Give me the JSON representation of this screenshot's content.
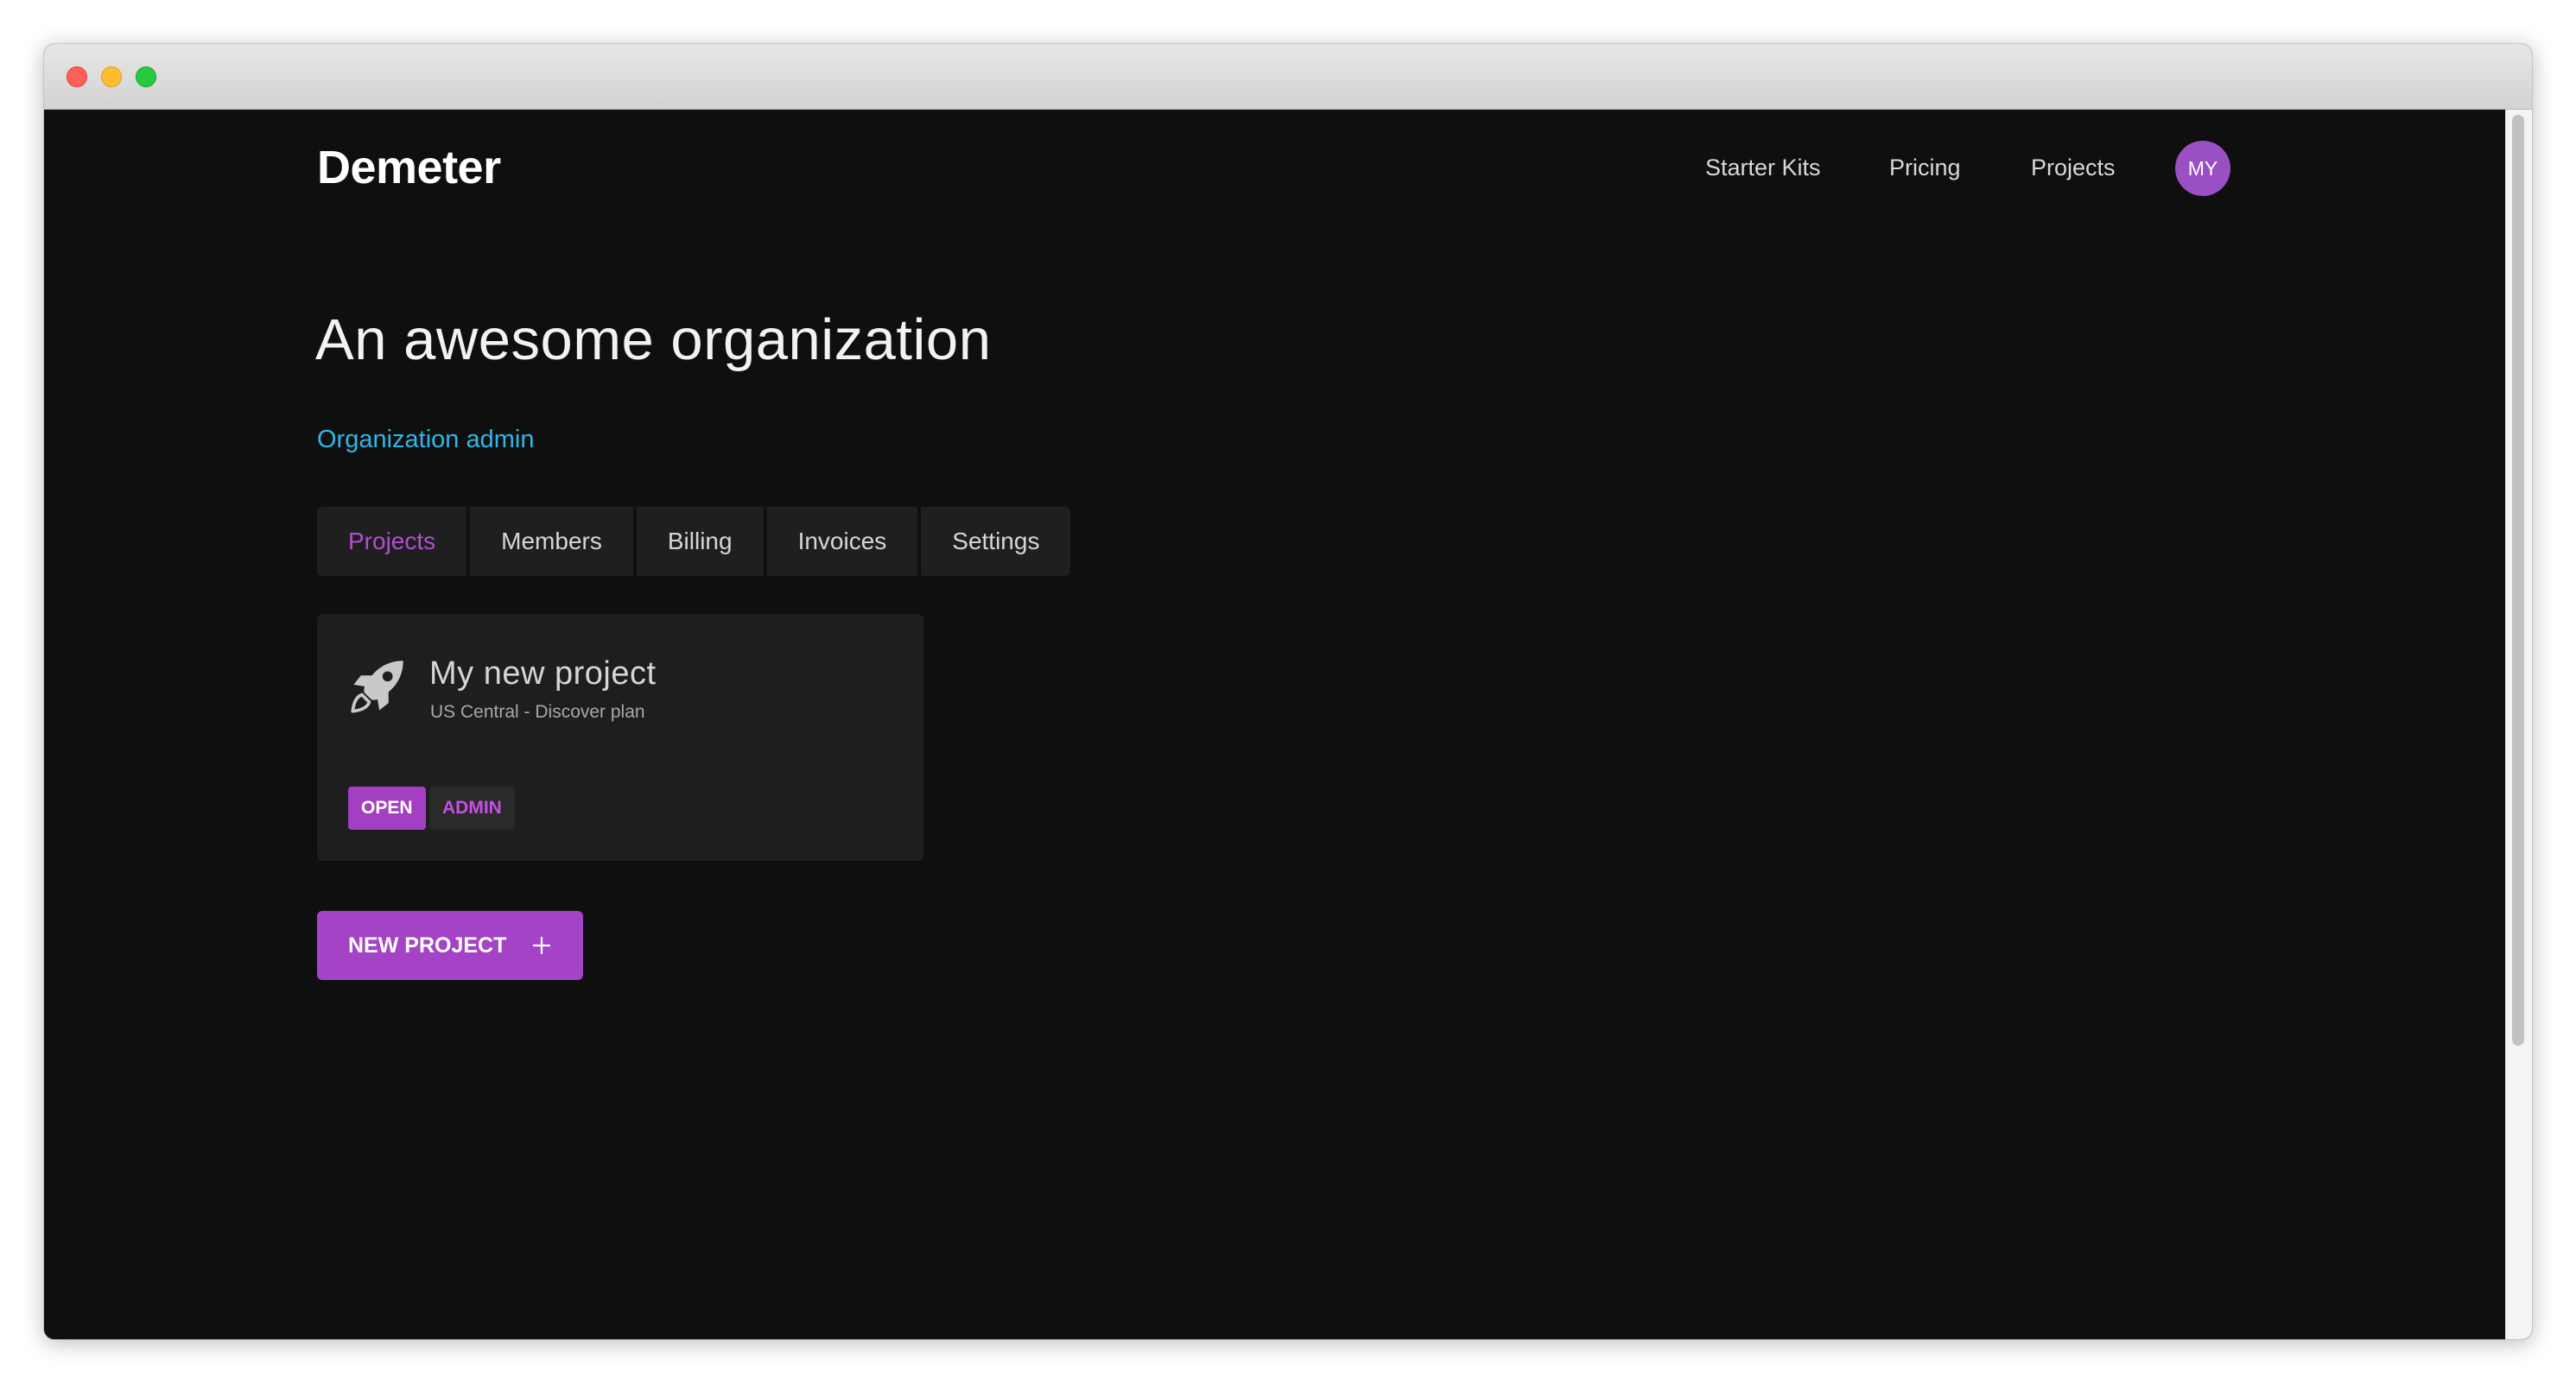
{
  "header": {
    "brand": "Demeter",
    "nav": [
      "Starter Kits",
      "Pricing",
      "Projects"
    ],
    "avatar_initials": "MY"
  },
  "organization": {
    "title": "An awesome organization",
    "role": "Organization admin"
  },
  "tabs": [
    {
      "label": "Projects",
      "active": true
    },
    {
      "label": "Members",
      "active": false
    },
    {
      "label": "Billing",
      "active": false
    },
    {
      "label": "Invoices",
      "active": false
    },
    {
      "label": "Settings",
      "active": false
    }
  ],
  "project_card": {
    "icon": "rocket-icon",
    "name": "My new project",
    "subtitle": "US Central - Discover plan",
    "badges": [
      "OPEN",
      "ADMIN"
    ]
  },
  "new_project_button": {
    "label": "NEW PROJECT",
    "icon": "plus-icon"
  },
  "colors": {
    "background": "#0f0f10",
    "accent": "#a543c6",
    "role_link": "#2fb7e6",
    "card": "#1e1e1f"
  }
}
